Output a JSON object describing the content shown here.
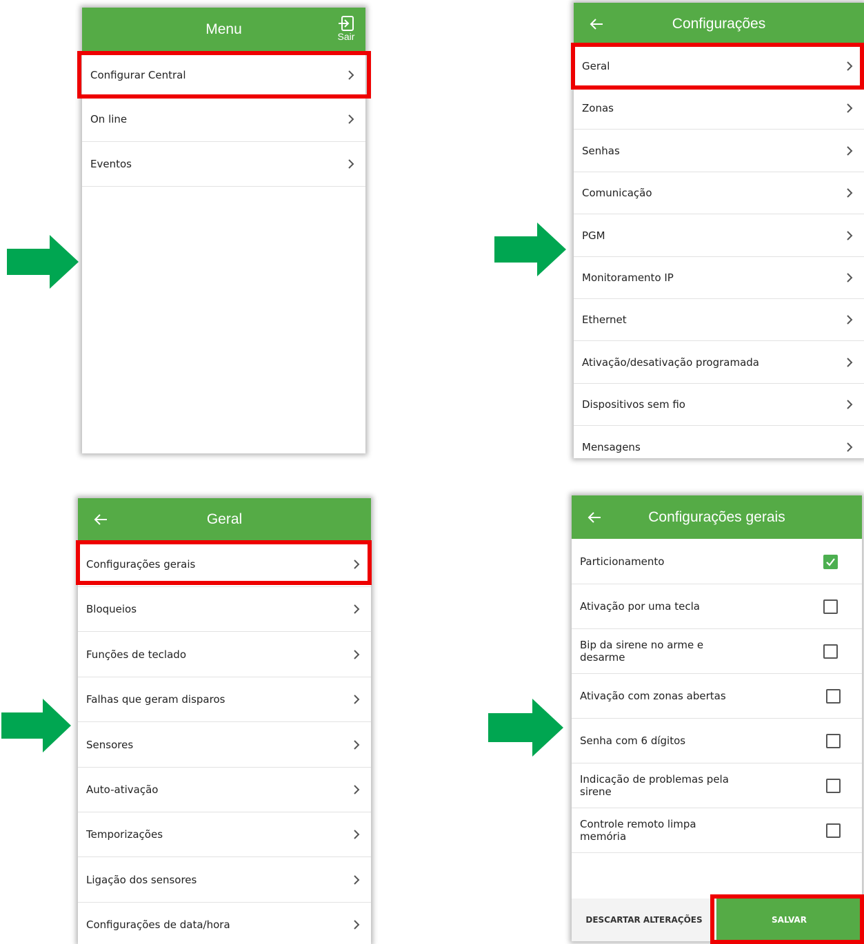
{
  "menu": {
    "title": "Menu",
    "exit_label": "Sair",
    "items": [
      {
        "label": "Configurar Central"
      },
      {
        "label": "On line"
      },
      {
        "label": "Eventos"
      }
    ]
  },
  "configuracoes": {
    "title": "Configurações",
    "items": [
      {
        "label": "Geral"
      },
      {
        "label": "Zonas"
      },
      {
        "label": "Senhas"
      },
      {
        "label": "Comunicação"
      },
      {
        "label": "PGM"
      },
      {
        "label": "Monitoramento IP"
      },
      {
        "label": "Ethernet"
      },
      {
        "label": "Ativação/desativação programada"
      },
      {
        "label": "Dispositivos sem fio"
      },
      {
        "label": "Mensagens"
      }
    ]
  },
  "geral": {
    "title": "Geral",
    "items": [
      {
        "label": "Configurações gerais"
      },
      {
        "label": "Bloqueios"
      },
      {
        "label": "Funções de teclado"
      },
      {
        "label": "Falhas que geram disparos"
      },
      {
        "label": "Sensores"
      },
      {
        "label": "Auto-ativação"
      },
      {
        "label": "Temporizações"
      },
      {
        "label": "Ligação dos sensores"
      },
      {
        "label": "Configurações de data/hora"
      }
    ]
  },
  "configuracoes_gerais": {
    "title": "Configurações gerais",
    "options": [
      {
        "label": "Particionamento",
        "checked": true
      },
      {
        "label": "Ativação por uma tecla",
        "checked": false
      },
      {
        "label": "Bip da sirene no arme e desarme",
        "checked": false
      },
      {
        "label": "Ativação com zonas abertas",
        "checked": false
      },
      {
        "label": "Senha com 6 dígitos",
        "checked": false
      },
      {
        "label": "Indicação de problemas pela sirene",
        "checked": false
      },
      {
        "label": "Controle remoto limpa memória",
        "checked": false
      }
    ],
    "discard_label": "DESCARTAR ALTERAÇÕES",
    "save_label": "SALVAR"
  },
  "colors": {
    "header_green": "#55ab46",
    "arrow_green": "#00a651",
    "highlight_red": "#ee0000",
    "check_green": "#4caf50"
  }
}
